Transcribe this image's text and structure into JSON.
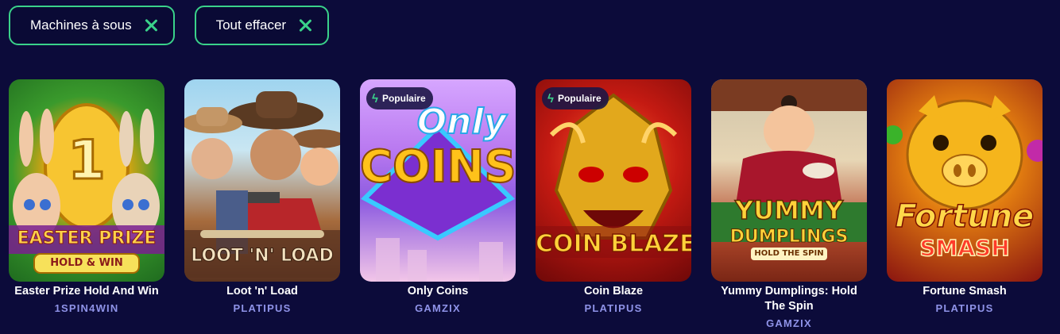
{
  "filters": {
    "chips": [
      {
        "label": "Machines à sous"
      },
      {
        "label": "Tout effacer"
      }
    ]
  },
  "games": [
    {
      "title": "Easter Prize Hold And Win",
      "provider": "1SPIN4WIN",
      "art_text": [
        "EASTER PRIZE",
        "HOLD & WIN"
      ],
      "badge": ""
    },
    {
      "title": "Loot 'n' Load",
      "provider": "PLATIPUS",
      "art_text": [
        "LOOT 'N' LOAD"
      ],
      "badge": ""
    },
    {
      "title": "Only Coins",
      "provider": "GAMZIX",
      "art_text": [
        "Only",
        "COINS"
      ],
      "badge": "Populaire"
    },
    {
      "title": "Coin Blaze",
      "provider": "PLATIPUS",
      "art_text": [
        "COIN BLAZE"
      ],
      "badge": "Populaire"
    },
    {
      "title": "Yummy Dumplings: Hold The Spin",
      "provider": "GAMZIX",
      "art_text": [
        "YUMMY",
        "DUMPLINGS",
        "HOLD THE SPIN"
      ],
      "badge": ""
    },
    {
      "title": "Fortune Smash",
      "provider": "PLATIPUS",
      "art_text": [
        "Fortune",
        "SMASH"
      ],
      "badge": ""
    }
  ],
  "colors": {
    "background": "#0c0b3a",
    "accent": "#3ad28a",
    "provider": "#8f93e8"
  },
  "icons": {
    "chip_remove": "close-icon",
    "badge": "bolt-icon"
  }
}
